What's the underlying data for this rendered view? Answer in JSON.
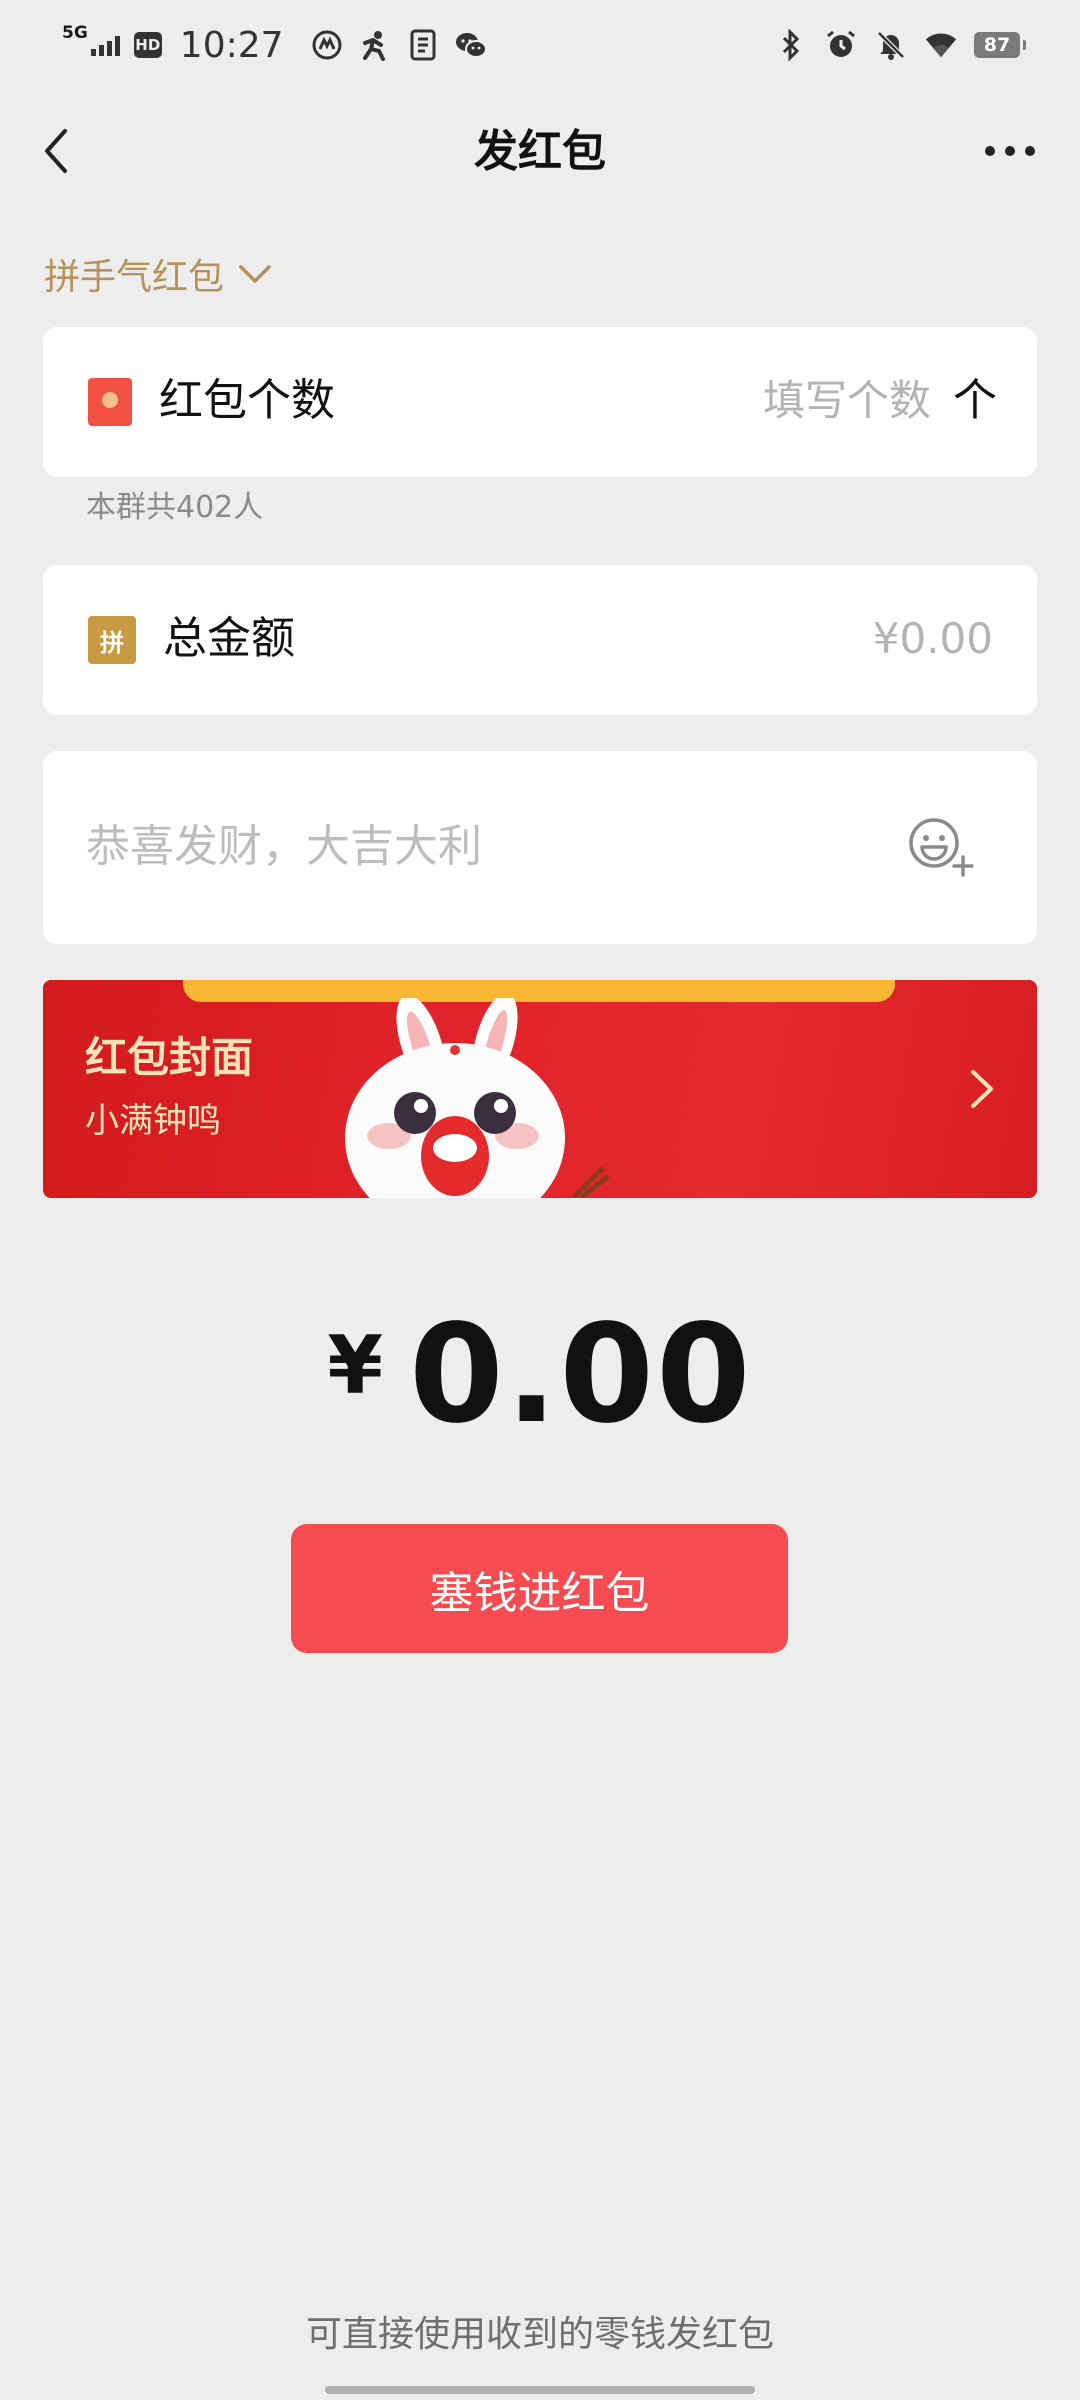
{
  "status_bar": {
    "network": "5G",
    "hd": "HD",
    "time": "10:27",
    "battery": "87",
    "icons_left": [
      "badge-icon",
      "runner-icon",
      "sim-icon",
      "wechat-icon"
    ],
    "icons_right": [
      "bluetooth-icon",
      "alarm-icon",
      "mute-icon",
      "wifi-icon",
      "battery-icon"
    ]
  },
  "nav": {
    "title": "发红包"
  },
  "type_switch": {
    "label": "拼手气红包"
  },
  "count_row": {
    "label": "红包个数",
    "placeholder": "填写个数",
    "unit": "个"
  },
  "group_hint": "本群共402人",
  "amount_row": {
    "icon_text": "拼",
    "label": "总金额",
    "placeholder": "¥0.00"
  },
  "greeting": {
    "placeholder": "恭喜发财，大吉大利"
  },
  "cover": {
    "title": "红包封面",
    "subtitle": "小满钟鸣"
  },
  "total": {
    "currency": "¥",
    "value": "0.00"
  },
  "submit_label": "塞钱进红包",
  "footer_note": "可直接使用收到的零钱发红包",
  "colors": {
    "background": "#ededed",
    "accent_gold": "#b6925a",
    "button_red": "#f64c51",
    "cover_red": "#e0232a"
  }
}
